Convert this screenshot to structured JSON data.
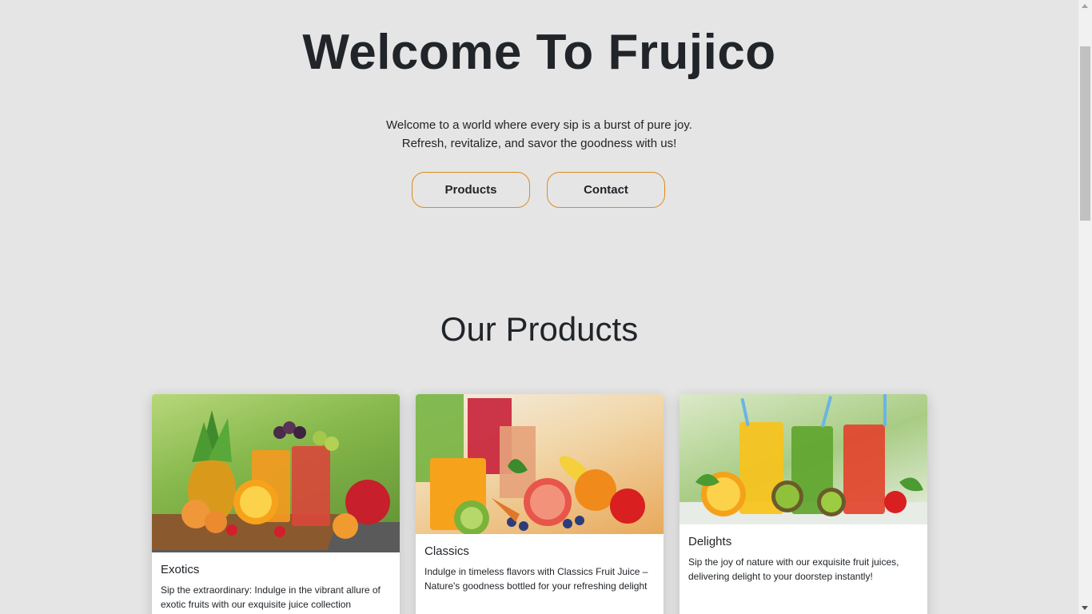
{
  "hero": {
    "title": "Welcome To Frujico",
    "subtitle_line1": "Welcome to a world where every sip is a burst of pure joy.",
    "subtitle_line2": "Refresh, revitalize, and savor the goodness with us!",
    "buttons": {
      "products": "Products",
      "contact": "Contact"
    }
  },
  "products": {
    "section_title": "Our Products",
    "cards": [
      {
        "title": "Exotics",
        "text": "Sip the extraordinary: Indulge in the vibrant allure of exotic fruits with our exquisite juice collection",
        "image": "exotic-fruit-juices-image"
      },
      {
        "title": "Classics",
        "text": "Indulge in timeless flavors with Classics Fruit Juice – Nature's goodness bottled for your refreshing delight",
        "image": "classic-fruit-juices-image"
      },
      {
        "title": "Delights",
        "text": "Sip the joy of nature with our exquisite fruit juices, delivering delight to your doorstep instantly!",
        "image": "delight-fruit-juices-image"
      }
    ]
  },
  "colors": {
    "background": "#e5e5e5",
    "accent_border": "#e08a1e",
    "text": "#212529",
    "card_background": "#ffffff"
  }
}
